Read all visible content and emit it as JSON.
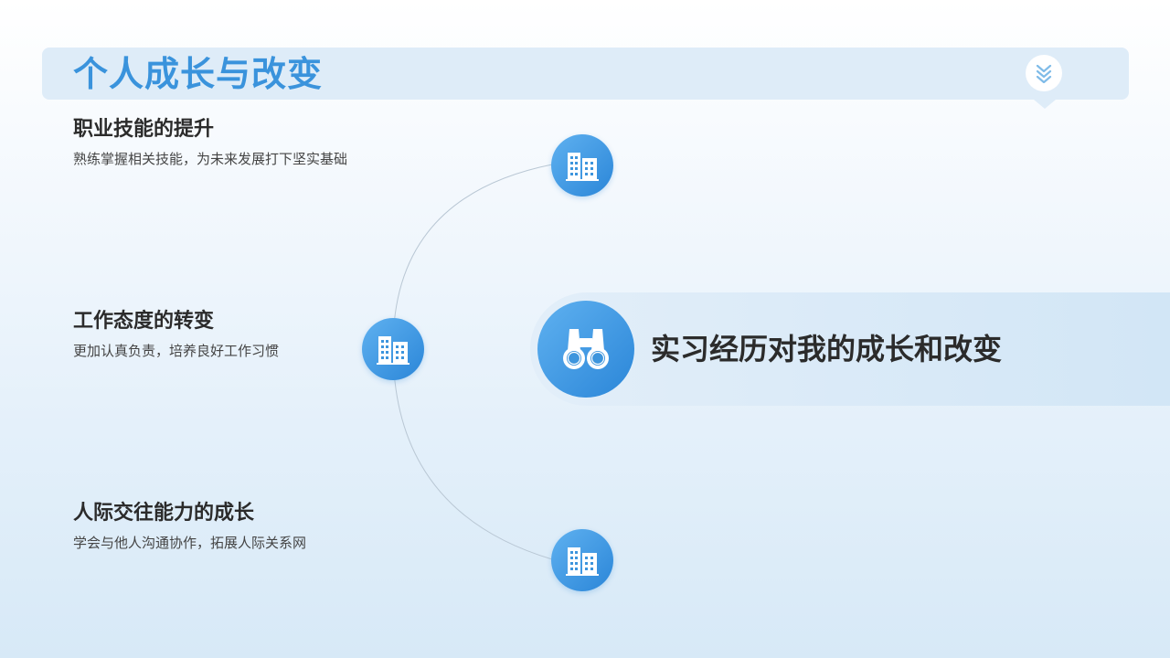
{
  "header": {
    "title": "个人成长与改变",
    "badge_icon": "double-chevron-down-icon"
  },
  "items": [
    {
      "title": "职业技能的提升",
      "desc": "熟练掌握相关技能，为未来发展打下坚实基础",
      "icon": "building-icon"
    },
    {
      "title": "工作态度的转变",
      "desc": "更加认真负责，培养良好工作习惯",
      "icon": "building-icon"
    },
    {
      "title": "人际交往能力的成长",
      "desc": "学会与他人沟通协作，拓展人际关系网",
      "icon": "building-icon"
    }
  ],
  "banner": {
    "text": "实习经历对我的成长和改变",
    "icon": "binoculars-icon"
  },
  "colors": {
    "accent": "#3a93dc",
    "node_gradient_start": "#5fb1f0",
    "node_gradient_end": "#2b86d8",
    "text_dark": "#2b2b2b"
  }
}
